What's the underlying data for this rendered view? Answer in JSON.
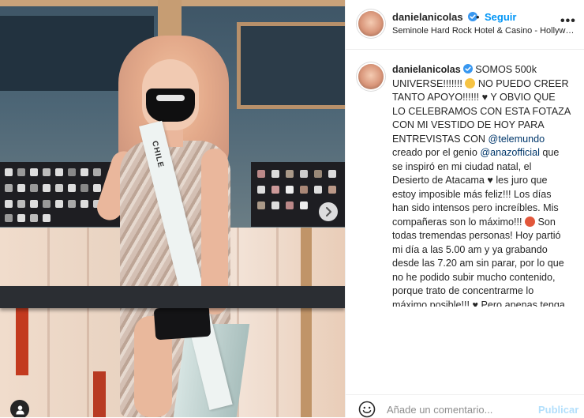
{
  "post": {
    "username": "danielanicolas",
    "follow_label": "Seguir",
    "separator": "•",
    "location": "Seminole Hard Rock Hotel & Casino - Hollyw…",
    "more_label": "•••",
    "sash_text": "CHILE"
  },
  "caption": {
    "username": "danielanicolas",
    "t1": " SOMOS 500k UNIVERSE!!!!!!! ",
    "t2": " NO PUEDO CREER TANTO APOYO!!!!!! ♥ Y OBVIO QUE LO CELEBRAMOS CON ESTA FOTAZA CON MI VESTIDO DE HOY PARA ENTREVISTAS CON ",
    "mention1": "@telemundo",
    "t3": " creado por el genio ",
    "mention2": "@anazofficial",
    "t4": " que se inspiró en mi ciudad natal, el Desierto de Atacama ♥ les juro que estoy imposible más feliz!!! Los días han sido intensos pero increíbles. Mis compañeras son lo máximo!!! ",
    "t5": " Son todas tremendas personas! Hoy partió mi día a las 5.00 am y ya grabando desde las 7.20 am sin parar, por lo que no he podido subir mucho contenido, porque trato de concentrarme lo máximo posible!!! ♥ Pero apenas tenga tiempo les voy contando sobre"
  },
  "comment_box": {
    "placeholder": "Añade un comentario...",
    "publish_label": "Publicar"
  }
}
